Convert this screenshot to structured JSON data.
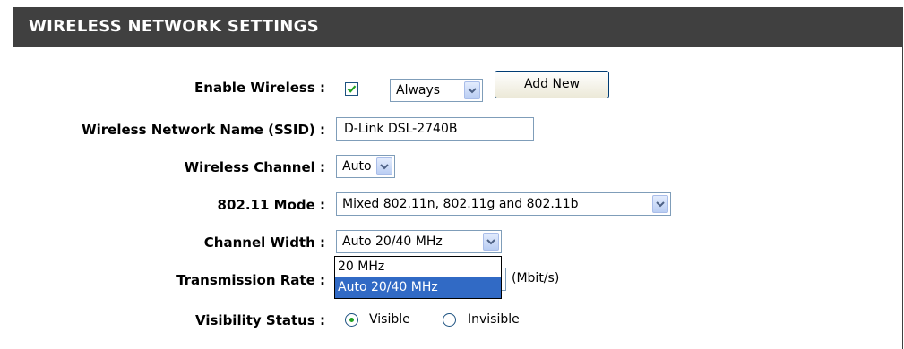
{
  "header": {
    "title": "WIRELESS NETWORK SETTINGS"
  },
  "rows": {
    "enable_wireless": {
      "label": "Enable Wireless :",
      "checked": true,
      "schedule_value": "Always",
      "add_new_label": "Add New"
    },
    "ssid": {
      "label": "Wireless Network Name (SSID) :",
      "value": "D-Link DSL-2740B"
    },
    "channel": {
      "label": "Wireless Channel :",
      "value": "Auto"
    },
    "mode": {
      "label": "802.11 Mode :",
      "value": "Mixed 802.11n, 802.11g and 802.11b"
    },
    "channel_width": {
      "label": "Channel Width :",
      "value": "Auto 20/40 MHz",
      "options": [
        "20 MHz",
        "Auto 20/40 MHz"
      ],
      "highlighted_option": "Auto 20/40 MHz"
    },
    "transmission_rate": {
      "label": "Transmission Rate :",
      "unit": "(Mbit/s)"
    },
    "visibility": {
      "label": "Visibility Status :",
      "selected": "Visible",
      "options": [
        "Visible",
        "Invisible"
      ]
    }
  },
  "colors": {
    "header_bg": "#404040",
    "highlight": "#316ac5",
    "radio_dot": "#21a121"
  },
  "icons": {
    "dropdown": "chevron-down-icon",
    "check": "checkmark-icon"
  }
}
